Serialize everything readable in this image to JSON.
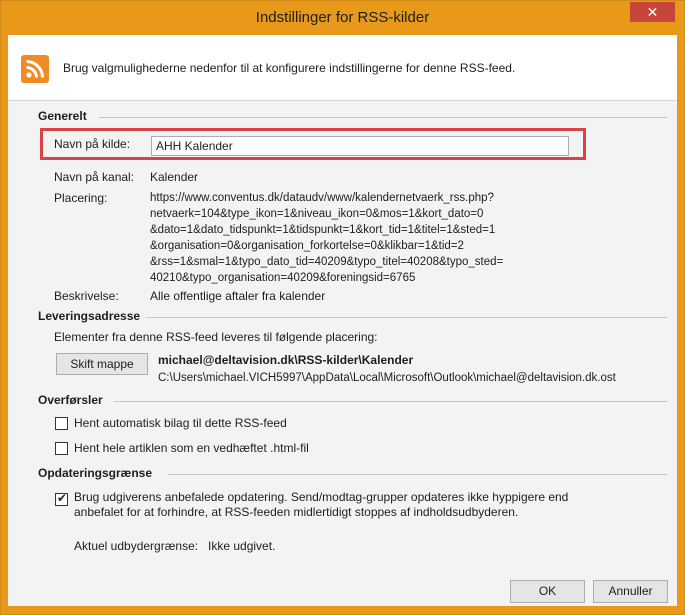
{
  "window": {
    "title": "Indstillinger for RSS-kilder",
    "close_glyph": "✕"
  },
  "header": {
    "icon": "rss-feed-icon",
    "text": "Brug valgmulighederne nedenfor til at konfigurere indstillingerne for denne RSS-feed."
  },
  "general": {
    "section_title": "Generelt",
    "source_name_label": "Navn på kilde:",
    "source_name_value": "AHH Kalender",
    "channel_name_label": "Navn på kanal:",
    "channel_name_value": "Kalender",
    "location_label": "Placering:",
    "location_value": "https://www.conventus.dk/dataudv/www/kalendernetvaerk_rss.php?\nnetvaerk=104&type_ikon=1&niveau_ikon=0&mos=1&kort_dato=0\n&dato=1&dato_tidspunkt=1&tidspunkt=1&kort_tid=1&titel=1&sted=1\n&organisation=0&organisation_forkortelse=0&klikbar=1&tid=2\n&rss=1&smal=1&typo_dato_tid=40209&typo_titel=40208&typo_sted=\n40210&typo_organisation=40209&foreningsid=6765",
    "description_label": "Beskrivelse:",
    "description_value": "Alle offentlige aftaler fra kalender"
  },
  "delivery": {
    "section_title": "Leveringsadresse",
    "intro": "Elementer fra denne RSS-feed leveres til følgende placering:",
    "change_folder_button": "Skift mappe",
    "folder_name": "michael@deltavision.dk\\RSS-kilder\\Kalender",
    "folder_path": "C:\\Users\\michael.VICH5997\\AppData\\Local\\Microsoft\\Outlook\\michael@deltavision.dk.ost"
  },
  "downloads": {
    "section_title": "Overførsler",
    "auto_attachment_label": "Hent automatisk bilag til dette RSS-feed",
    "auto_attachment_checked": false,
    "full_article_label": "Hent hele artiklen som en vedhæftet .html-fil",
    "full_article_checked": false
  },
  "update_limit": {
    "section_title": "Opdateringsgrænse",
    "use_publisher_label_line1": "Brug udgiverens anbefalede opdatering. Send/modtag-grupper opdateres ikke hyppigere end",
    "use_publisher_label_line2": "anbefalet for at forhindre, at RSS-feeden midlertidigt stoppes af indholdsudbyderen.",
    "use_publisher_checked": true,
    "current_limit_label": "Aktuel udbydergrænse:",
    "current_limit_value": "Ikke udgivet."
  },
  "footer": {
    "ok_button": "OK",
    "cancel_button": "Annuller"
  },
  "colors": {
    "title_bar": "#e8991a",
    "close_button": "#c7463c",
    "highlight_border": "#d94347",
    "rss_orange": "#f08a24"
  }
}
